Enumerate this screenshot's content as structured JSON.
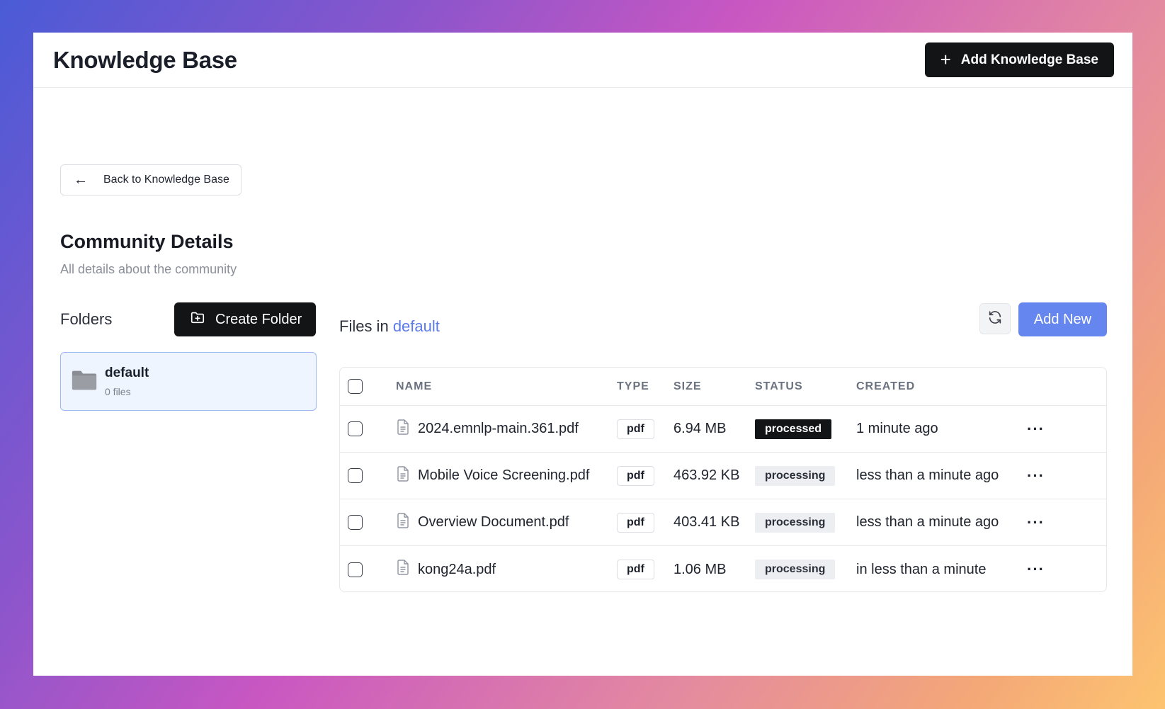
{
  "header": {
    "title": "Knowledge Base",
    "add_button_icon": "plus-icon",
    "add_button_label": "Add Knowledge Base"
  },
  "back_button": {
    "icon": "arrow-left-icon",
    "label": "Back to Knowledge Base"
  },
  "section": {
    "title": "Community Details",
    "subtitle": "All details about the community"
  },
  "folders": {
    "label": "Folders",
    "create_label": "Create Folder",
    "create_icon": "folder-plus-icon",
    "items": [
      {
        "name": "default",
        "count": "0 files",
        "icon": "folder-icon"
      }
    ]
  },
  "files": {
    "title_prefix": "Files in",
    "folder": "default",
    "refresh_icon": "refresh-icon",
    "add_new_label": "Add New",
    "columns": [
      "NAME",
      "TYPE",
      "SIZE",
      "STATUS",
      "CREATED"
    ],
    "rows": [
      {
        "name": "2024.emnlp-main.361.pdf",
        "type": "pdf",
        "size": "6.94 MB",
        "status": "processed",
        "created": "1 minute ago"
      },
      {
        "name": "Mobile Voice Screening.pdf",
        "type": "pdf",
        "size": "463.92 KB",
        "status": "processing",
        "created": "less than a minute ago"
      },
      {
        "name": "Overview Document.pdf",
        "type": "pdf",
        "size": "403.41 KB",
        "status": "processing",
        "created": "less than a minute ago"
      },
      {
        "name": "kong24a.pdf",
        "type": "pdf",
        "size": "1.06 MB",
        "status": "processing",
        "created": "in less than a minute"
      }
    ],
    "more_label": "···"
  },
  "colors": {
    "accent": "#6585ef",
    "dark": "#131416",
    "folder_selected_bg": "#eef5ff",
    "folder_selected_border": "#9db8f3"
  }
}
